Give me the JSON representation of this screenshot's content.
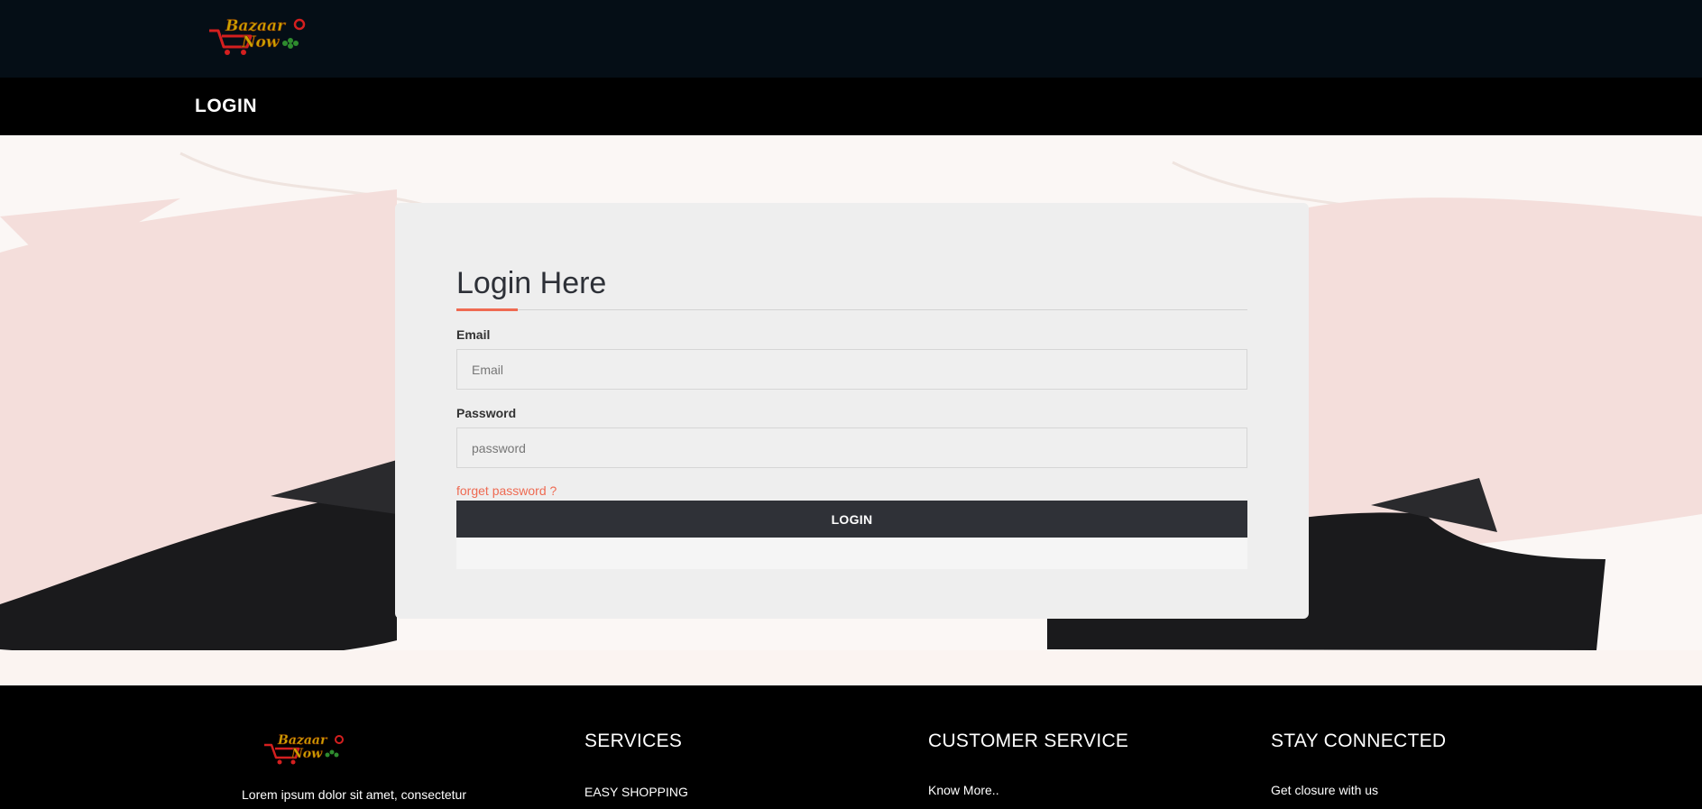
{
  "header": {
    "logo_text_line1": "Bazaar",
    "logo_text_line2": "Now"
  },
  "title_bar": {
    "title": "LOGIN"
  },
  "login_form": {
    "heading": "Login Here",
    "email_label": "Email",
    "email_placeholder": "Email",
    "email_value": "",
    "password_label": "Password",
    "password_placeholder": "password",
    "password_value": "",
    "forgot_link": "forget password ?",
    "submit_label": "LOGIN"
  },
  "footer": {
    "logo_text_line1": "Bazaar",
    "logo_text_line2": "Now",
    "description": "Lorem ipsum dolor sit amet, consectetur",
    "columns": [
      {
        "heading": "SERVICES",
        "first_link": "EASY SHOPPING"
      },
      {
        "heading": "CUSTOMER SERVICE",
        "first_link": "Know More.."
      },
      {
        "heading": "STAY CONNECTED",
        "first_link": "Get closure with us"
      }
    ]
  },
  "colors": {
    "header_bg": "#050e16",
    "title_bar_bg": "#000000",
    "card_bg": "#eeeeee",
    "accent": "#ef6a52",
    "button_bg": "#2f3137",
    "footer_bg": "#000000"
  }
}
